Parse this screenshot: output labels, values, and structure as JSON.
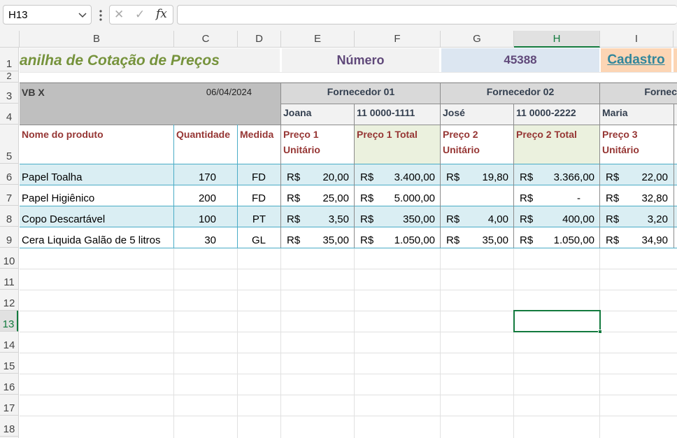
{
  "formula_bar": {
    "name_box": "H13",
    "cancel_glyph": "✕",
    "enter_glyph": "✓",
    "fx_label": "fx",
    "formula": ""
  },
  "columns": [
    "B",
    "C",
    "D",
    "E",
    "F",
    "G",
    "H",
    "I"
  ],
  "rows": [
    "1",
    "2",
    "3",
    "4",
    "5",
    "6",
    "7",
    "8",
    "9",
    "10",
    "11",
    "12",
    "13",
    "14",
    "15",
    "16",
    "17",
    "18"
  ],
  "header": {
    "title": "anilha de Cotação de Preços",
    "numero_label": "Número",
    "numero_value": "45388",
    "cadastro_link": "Cadastro"
  },
  "info": {
    "code": "VB X",
    "date": "06/04/2024"
  },
  "suppliers": [
    {
      "name": "Fornecedor 01",
      "contact": "Joana",
      "phone": "11 0000-1111"
    },
    {
      "name": "Fornecedor 02",
      "contact": "José",
      "phone": "11 0000-2222"
    },
    {
      "name": "Fornec",
      "contact": "Maria"
    }
  ],
  "table_headers": {
    "product": "Nome do produto",
    "quantity": "Quantidade",
    "unit": "Medida",
    "p1_unit": "Preço 1 Unitário",
    "p1_total": "Preço 1 Total",
    "p2_unit": "Preço 2 Unitário",
    "p2_total": "Preço 2 Total",
    "p3_unit": "Preço 3 Unitário"
  },
  "currency": "R$",
  "items": [
    {
      "product": "Papel Toalha",
      "qty": "170",
      "unit": "FD",
      "p1u": "20,00",
      "p1t": "3.400,00",
      "p2u": "19,80",
      "p2t": "3.366,00",
      "p3u": "22,00"
    },
    {
      "product": "Papel Higiênico",
      "qty": "200",
      "unit": "FD",
      "p1u": "25,00",
      "p1t": "5.000,00",
      "p2u": "",
      "p2t": "-",
      "p3u": "32,80"
    },
    {
      "product": "Copo Descartável",
      "qty": "100",
      "unit": "PT",
      "p1u": "3,50",
      "p1t": "350,00",
      "p2u": "4,00",
      "p2t": "400,00",
      "p3u": "3,20"
    },
    {
      "product": "Cera Liquida Galão de 5 litros",
      "qty": "30",
      "unit": "GL",
      "p1u": "35,00",
      "p1t": "1.050,00",
      "p2u": "35,00",
      "p2t": "1.050,00",
      "p3u": "34,90"
    }
  ],
  "colors": {
    "title_green": "#76933c",
    "header_red": "#963634",
    "row_teal": "#daeef3",
    "total_green": "#ebf1de",
    "numero_purple": "#60497a",
    "selection_green": "#137a3e"
  },
  "selected_cell": "H13"
}
